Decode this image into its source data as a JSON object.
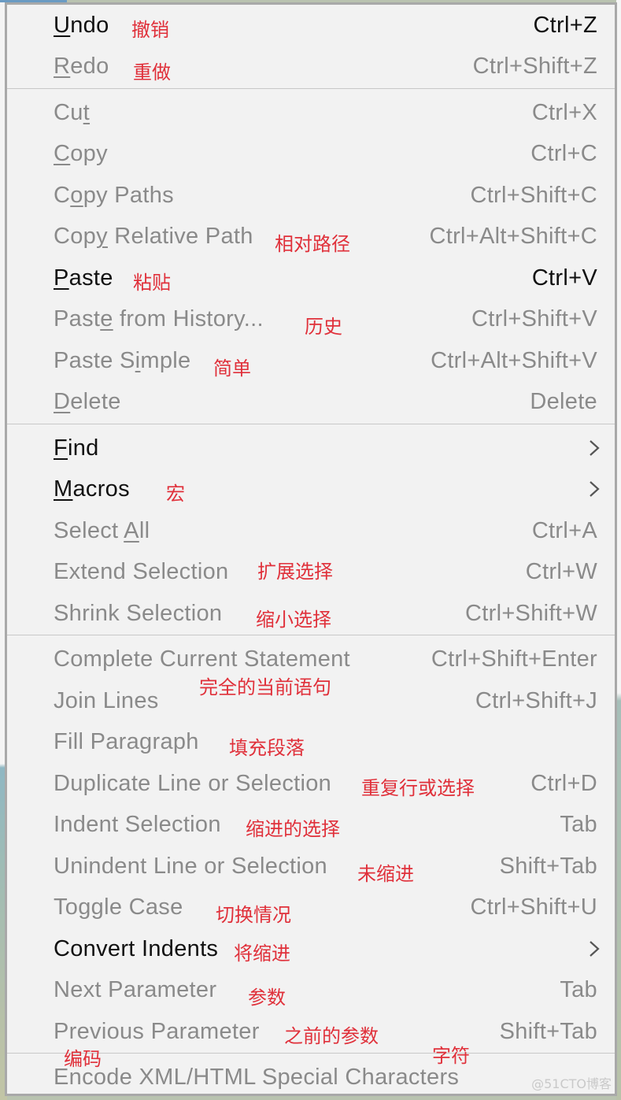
{
  "menu": {
    "groups": [
      [
        {
          "pre": "",
          "mn": "U",
          "post": "ndo",
          "shortcut": "Ctrl+Z",
          "enabled": true,
          "cn": "撤销"
        },
        {
          "pre": "",
          "mn": "R",
          "post": "edo",
          "shortcut": "Ctrl+Shift+Z",
          "enabled": false,
          "cn": "重做"
        }
      ],
      [
        {
          "pre": "Cu",
          "mn": "t",
          "post": "",
          "shortcut": "Ctrl+X",
          "enabled": false,
          "cn": ""
        },
        {
          "pre": "",
          "mn": "C",
          "post": "opy",
          "shortcut": "Ctrl+C",
          "enabled": false,
          "cn": ""
        },
        {
          "pre": "C",
          "mn": "o",
          "post": "py Paths",
          "shortcut": "Ctrl+Shift+C",
          "enabled": false,
          "cn": ""
        },
        {
          "pre": "Cop",
          "mn": "y",
          "post": " Relative Path",
          "shortcut": "Ctrl+Alt+Shift+C",
          "enabled": false,
          "cn": "相对路径"
        },
        {
          "pre": "",
          "mn": "P",
          "post": "aste",
          "shortcut": "Ctrl+V",
          "enabled": true,
          "cn": "粘贴"
        },
        {
          "pre": "Past",
          "mn": "e",
          "post": " from History...",
          "shortcut": "Ctrl+Shift+V",
          "enabled": false,
          "cn": "历史"
        },
        {
          "pre": "Paste S",
          "mn": "i",
          "post": "mple",
          "shortcut": "Ctrl+Alt+Shift+V",
          "enabled": false,
          "cn": "简单"
        },
        {
          "pre": "",
          "mn": "D",
          "post": "elete",
          "shortcut": "Delete",
          "enabled": false,
          "cn": ""
        }
      ],
      [
        {
          "pre": "",
          "mn": "F",
          "post": "ind",
          "shortcut": "",
          "submenu": true,
          "enabled": true,
          "cn": ""
        },
        {
          "pre": "",
          "mn": "M",
          "post": "acros",
          "shortcut": "",
          "submenu": true,
          "enabled": true,
          "cn": "宏"
        },
        {
          "pre": "Select ",
          "mn": "A",
          "post": "ll",
          "shortcut": "Ctrl+A",
          "enabled": false,
          "cn": ""
        },
        {
          "pre": "Extend Selection",
          "mn": "",
          "post": "",
          "shortcut": "Ctrl+W",
          "enabled": false,
          "cn": "扩展选择"
        },
        {
          "pre": "Shrink Selection",
          "mn": "",
          "post": "",
          "shortcut": "Ctrl+Shift+W",
          "enabled": false,
          "cn": "缩小选择"
        }
      ],
      [
        {
          "pre": "Complete Current Statement",
          "mn": "",
          "post": "",
          "shortcut": "Ctrl+Shift+Enter",
          "enabled": false,
          "cn": "完全的当前语句"
        },
        {
          "pre": "Join Lines",
          "mn": "",
          "post": "",
          "shortcut": "Ctrl+Shift+J",
          "enabled": false,
          "cn": ""
        },
        {
          "pre": "Fill Paragraph",
          "mn": "",
          "post": "",
          "shortcut": "",
          "enabled": false,
          "cn": "填充段落"
        },
        {
          "pre": "Duplicate Line or Selection",
          "mn": "",
          "post": "",
          "shortcut": "Ctrl+D",
          "enabled": false,
          "cn": "重复行或选择"
        },
        {
          "pre": "Indent Selection",
          "mn": "",
          "post": "",
          "shortcut": "Tab",
          "enabled": false,
          "cn": "缩进的选择"
        },
        {
          "pre": "Unindent Line or Selection",
          "mn": "",
          "post": "",
          "shortcut": "Shift+Tab",
          "enabled": false,
          "cn": "未缩进"
        },
        {
          "pre": "Toggle Case",
          "mn": "",
          "post": "",
          "shortcut": "Ctrl+Shift+U",
          "enabled": false,
          "cn": "切换情况"
        },
        {
          "pre": "Convert Indents",
          "mn": "",
          "post": "",
          "shortcut": "",
          "submenu": true,
          "enabled": true,
          "cn": "将缩进"
        },
        {
          "pre": "Next Parameter",
          "mn": "",
          "post": "",
          "shortcut": "Tab",
          "enabled": false,
          "cn": "参数"
        },
        {
          "pre": "Previous Parameter",
          "mn": "",
          "post": "",
          "shortcut": "Shift+Tab",
          "enabled": false,
          "cn": "之前的参数"
        }
      ],
      [
        {
          "pre": "Encode XML/HTML Special Characters",
          "mn": "",
          "post": "",
          "shortcut": "",
          "enabled": false,
          "cn": ""
        }
      ]
    ],
    "extra_annotations": [
      {
        "text": "编码",
        "near": "encode-xml-html"
      },
      {
        "text": "字符",
        "near": "encode-xml-html"
      }
    ]
  },
  "watermark": "@51CTO博客"
}
